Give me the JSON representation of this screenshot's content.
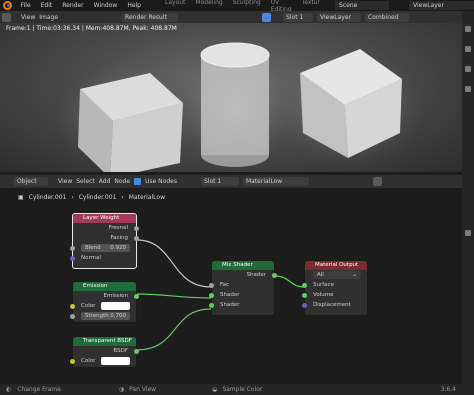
{
  "topbar": {
    "menus": [
      "File",
      "Edit",
      "Render",
      "Window",
      "Help"
    ],
    "workspaces": [
      "Layout",
      "Modeling",
      "Sculpting",
      "UV Editing",
      "Textur"
    ],
    "scene": "Scene",
    "view_layer": "ViewLayer"
  },
  "viewport_header": {
    "view": "View",
    "image": "Image",
    "render_result": "Render Result",
    "slot": "Slot 1",
    "view_layer": "ViewLayer",
    "combined": "Combined"
  },
  "render_stats": "Frame:1 | Time:03:36.34 | Mem:408.87M, Peak: 408.87M",
  "node_header": {
    "mode": "Object",
    "menus": [
      "View",
      "Select",
      "Add",
      "Node"
    ],
    "use_nodes": "Use Nodes",
    "slot": "Slot 1",
    "material": "MaterialLow"
  },
  "breadcrumb": [
    "Cylinder.001",
    "Cylinder.001",
    "MaterialLow"
  ],
  "nodes": {
    "layer_weight": {
      "title": "Layer Weight",
      "fresnel": "Fresnel",
      "facing": "Facing",
      "blend_label": "Blend",
      "blend_value": "0.920",
      "normal": "Normal"
    },
    "emission": {
      "title": "Emission",
      "out": "Emission",
      "color": "Color",
      "strength_label": "Strength",
      "strength_value": "0.700"
    },
    "transparent": {
      "title": "Transparent BSDF",
      "out": "BSDF",
      "color": "Color"
    },
    "mix": {
      "title": "Mix Shader",
      "out": "Shader",
      "fac": "Fac",
      "s1": "Shader",
      "s2": "Shader"
    },
    "output": {
      "title": "Material Output",
      "target": "All",
      "surface": "Surface",
      "volume": "Volume",
      "displacement": "Displacement"
    }
  },
  "status": {
    "change_frame": "Change Frame",
    "pan_view": "Pan View",
    "sample_color": "Sample Color",
    "version": "3.6.4"
  },
  "colors": {
    "header_pink": "#a23b5a",
    "header_green": "#1f6b3a",
    "header_red": "#7a2a30",
    "shader_socket": "#5fd05f",
    "color_socket": "#c7c729",
    "float_socket": "#a1a1a1",
    "vector_socket": "#6363c7"
  }
}
